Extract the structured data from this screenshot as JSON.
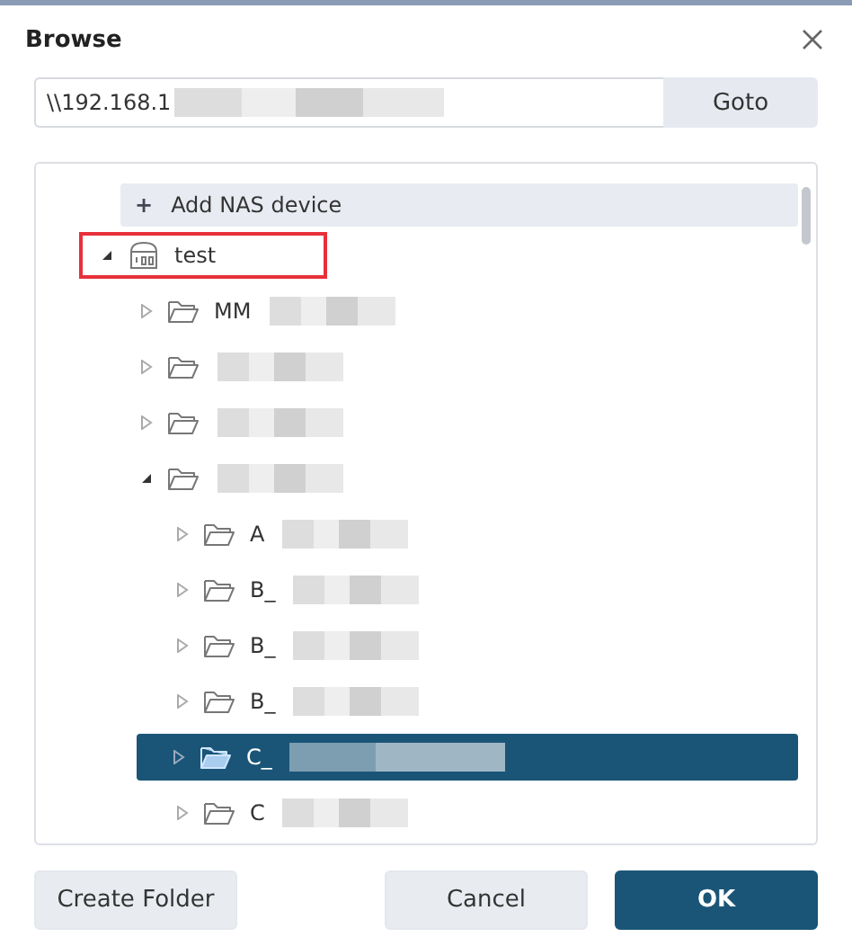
{
  "window": {
    "title": "Browse"
  },
  "path_field": {
    "value": "\\\\192.168.1",
    "redacted": true
  },
  "goto_button": "Goto",
  "add_device": {
    "icon": "+",
    "label": "Add NAS device"
  },
  "tree": [
    {
      "kind": "nas",
      "name": "test",
      "expanded": true,
      "highlighted": true,
      "selected": false,
      "children": [
        {
          "kind": "folder",
          "name": "MM",
          "expanded": false,
          "selected": false,
          "redacted": true
        },
        {
          "kind": "folder",
          "expanded": false,
          "selected": false,
          "redacted": true
        },
        {
          "kind": "folder",
          "expanded": false,
          "selected": false,
          "redacted": true
        },
        {
          "kind": "folder",
          "expanded": true,
          "selected": false,
          "redacted": true,
          "children": [
            {
              "kind": "folder",
              "name": "A",
              "expanded": false,
              "selected": false,
              "redacted": true
            },
            {
              "kind": "folder",
              "name": "B_",
              "expanded": false,
              "selected": false,
              "redacted": true
            },
            {
              "kind": "folder",
              "name": "B_",
              "expanded": false,
              "selected": false,
              "redacted": true
            },
            {
              "kind": "folder",
              "name": "B_",
              "expanded": false,
              "selected": false,
              "redacted": true
            },
            {
              "kind": "folder",
              "name": "C_",
              "expanded": false,
              "selected": true,
              "redacted": true
            },
            {
              "kind": "folder",
              "name": "C",
              "expanded": false,
              "selected": false,
              "redacted": true
            }
          ]
        }
      ]
    }
  ],
  "buttons": [
    {
      "kind": "secondary",
      "label": "Create Folder"
    },
    {
      "kind": "secondary",
      "label": "Cancel"
    },
    {
      "kind": "primary",
      "label": "OK"
    }
  ]
}
